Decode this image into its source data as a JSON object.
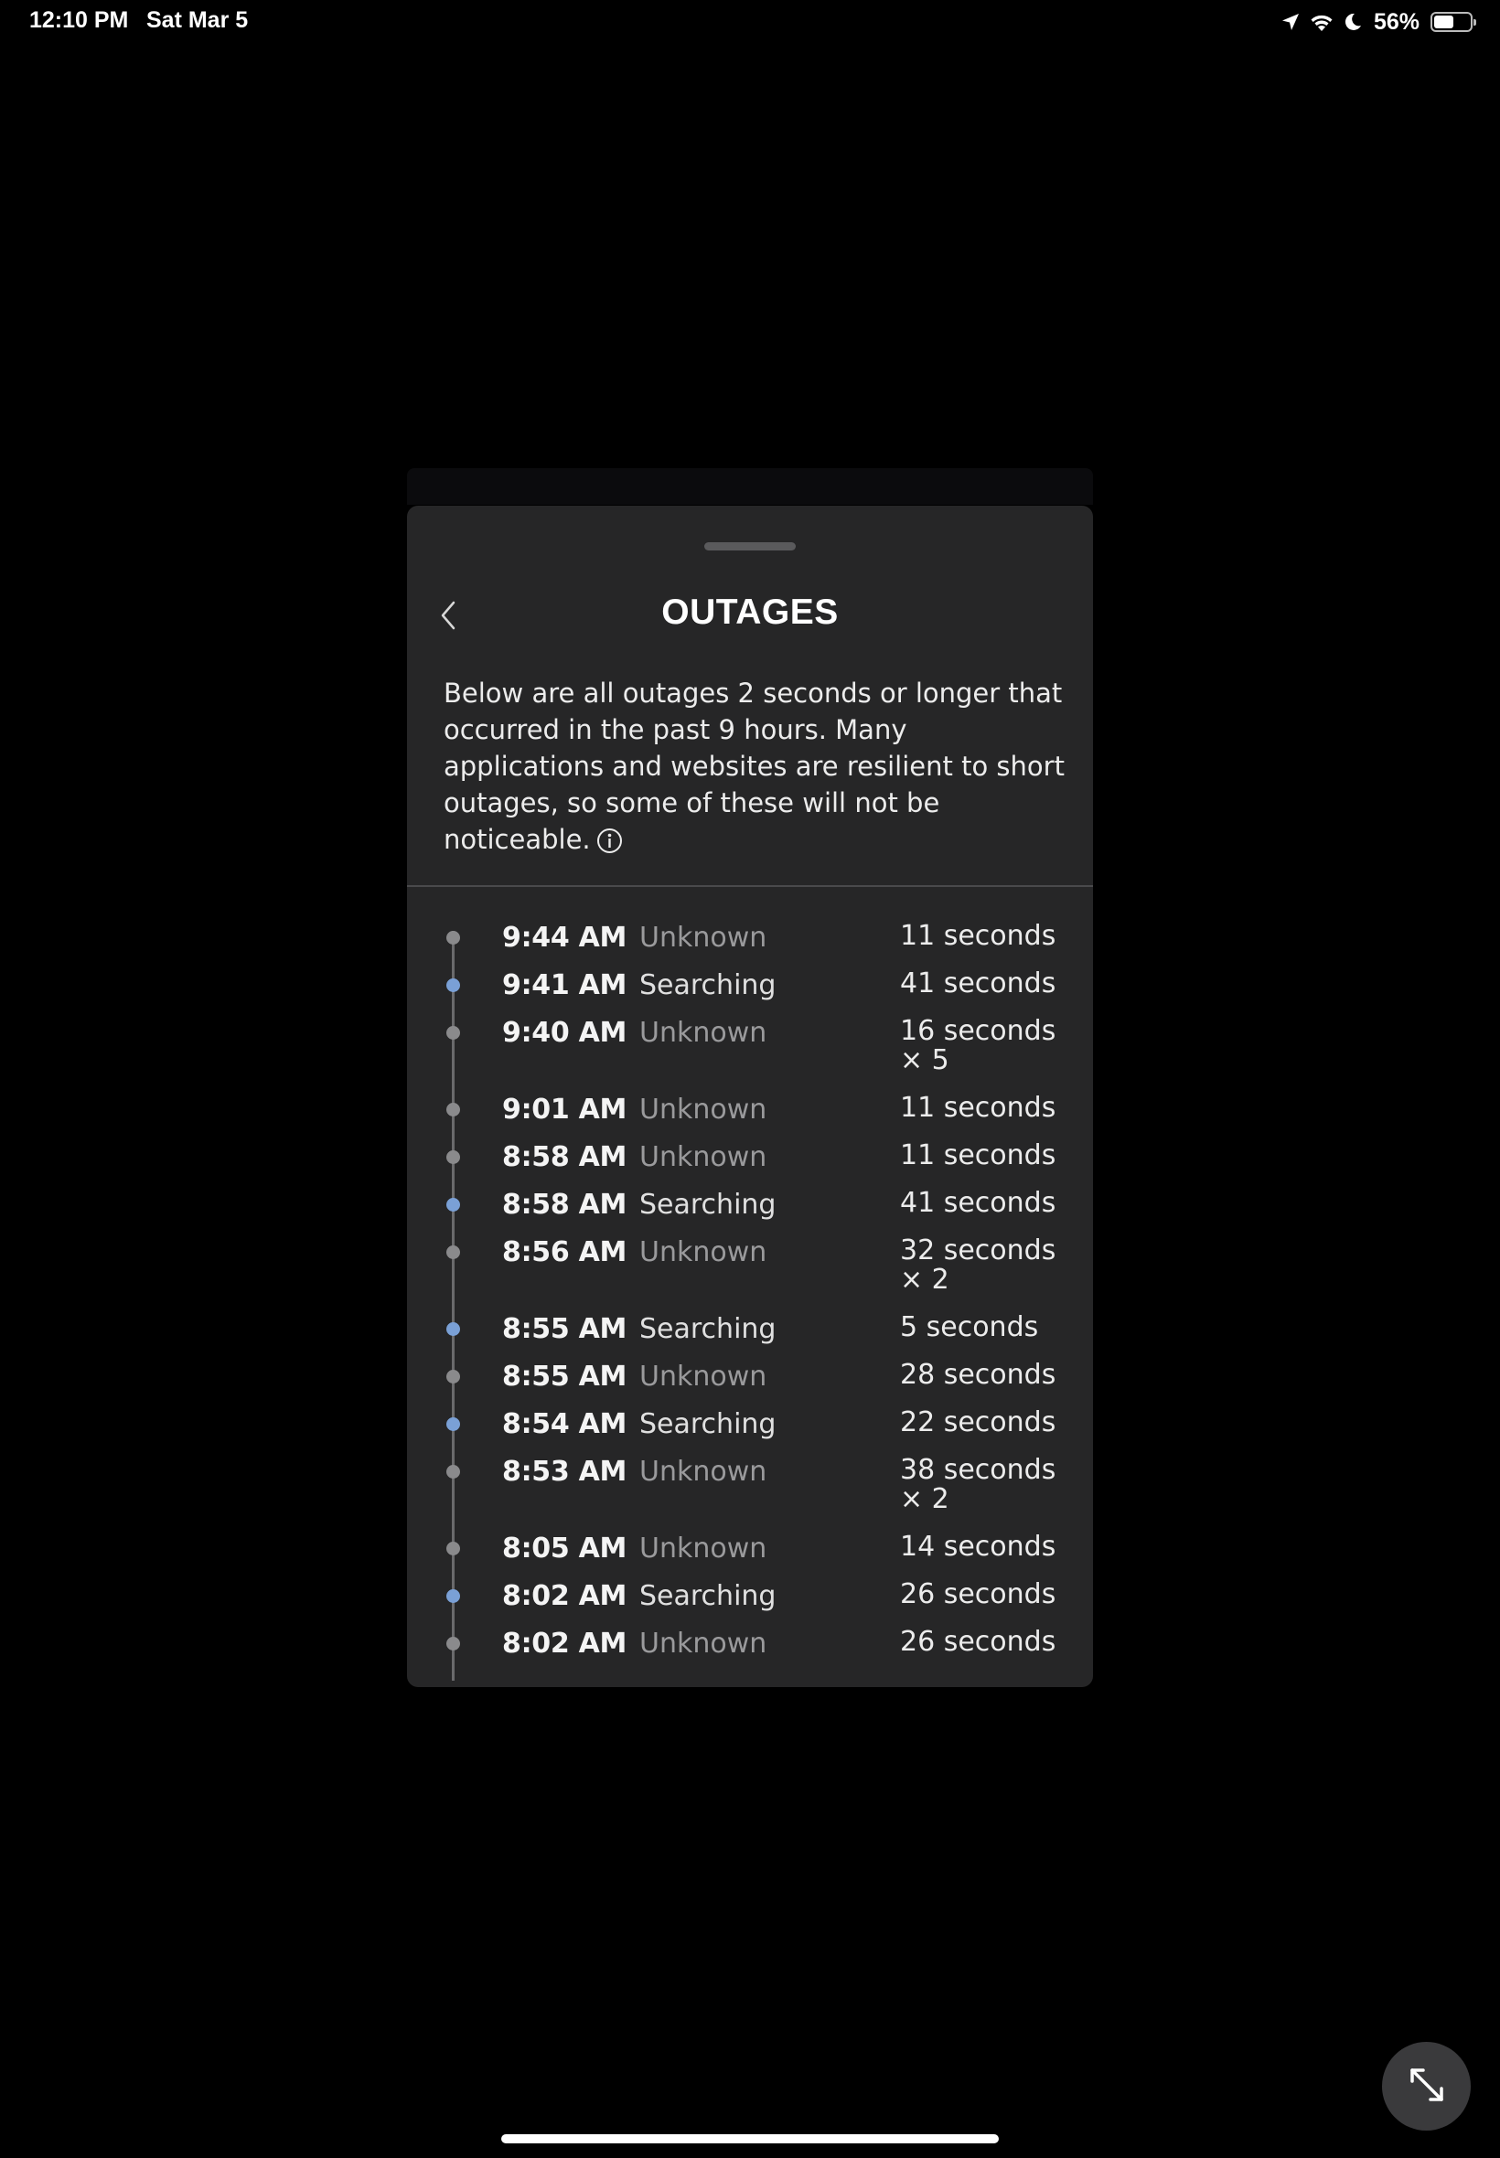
{
  "status_bar": {
    "time": "12:10 PM",
    "date": "Sat Mar 5",
    "battery_percent": "56%",
    "battery_level": 0.56,
    "icons": [
      "location-icon",
      "wifi-icon",
      "moon-icon",
      "battery-icon"
    ]
  },
  "sheet": {
    "title": "OUTAGES",
    "description": "Below are all outages 2 seconds or longer that occurred in the past 9 hours. Many applications and websites are resilient to short outages, so some of these will not be noticeable.",
    "back_icon": "chevron-left-icon",
    "info_icon": "info-icon"
  },
  "outages": [
    {
      "time": "9:44 AM",
      "type": "Unknown",
      "duration": "11 seconds"
    },
    {
      "time": "9:41 AM",
      "type": "Searching",
      "duration": "41 seconds"
    },
    {
      "time": "9:40 AM",
      "type": "Unknown",
      "duration": "16 seconds × 5"
    },
    {
      "time": "9:01 AM",
      "type": "Unknown",
      "duration": "11 seconds"
    },
    {
      "time": "8:58 AM",
      "type": "Unknown",
      "duration": "11 seconds"
    },
    {
      "time": "8:58 AM",
      "type": "Searching",
      "duration": "41 seconds"
    },
    {
      "time": "8:56 AM",
      "type": "Unknown",
      "duration": "32 seconds × 2"
    },
    {
      "time": "8:55 AM",
      "type": "Searching",
      "duration": "5 seconds"
    },
    {
      "time": "8:55 AM",
      "type": "Unknown",
      "duration": "28 seconds"
    },
    {
      "time": "8:54 AM",
      "type": "Searching",
      "duration": "22 seconds"
    },
    {
      "time": "8:53 AM",
      "type": "Unknown",
      "duration": "38 seconds × 2"
    },
    {
      "time": "8:05 AM",
      "type": "Unknown",
      "duration": "14 seconds"
    },
    {
      "time": "8:02 AM",
      "type": "Searching",
      "duration": "26 seconds"
    },
    {
      "time": "8:02 AM",
      "type": "Unknown",
      "duration": "26 seconds"
    }
  ],
  "colors": {
    "background": "#000000",
    "sheet": "#262627",
    "searching_dot": "#7aa0d6",
    "unknown_dot": "#8a8a8c"
  },
  "floating_button_icon": "expand-icon"
}
